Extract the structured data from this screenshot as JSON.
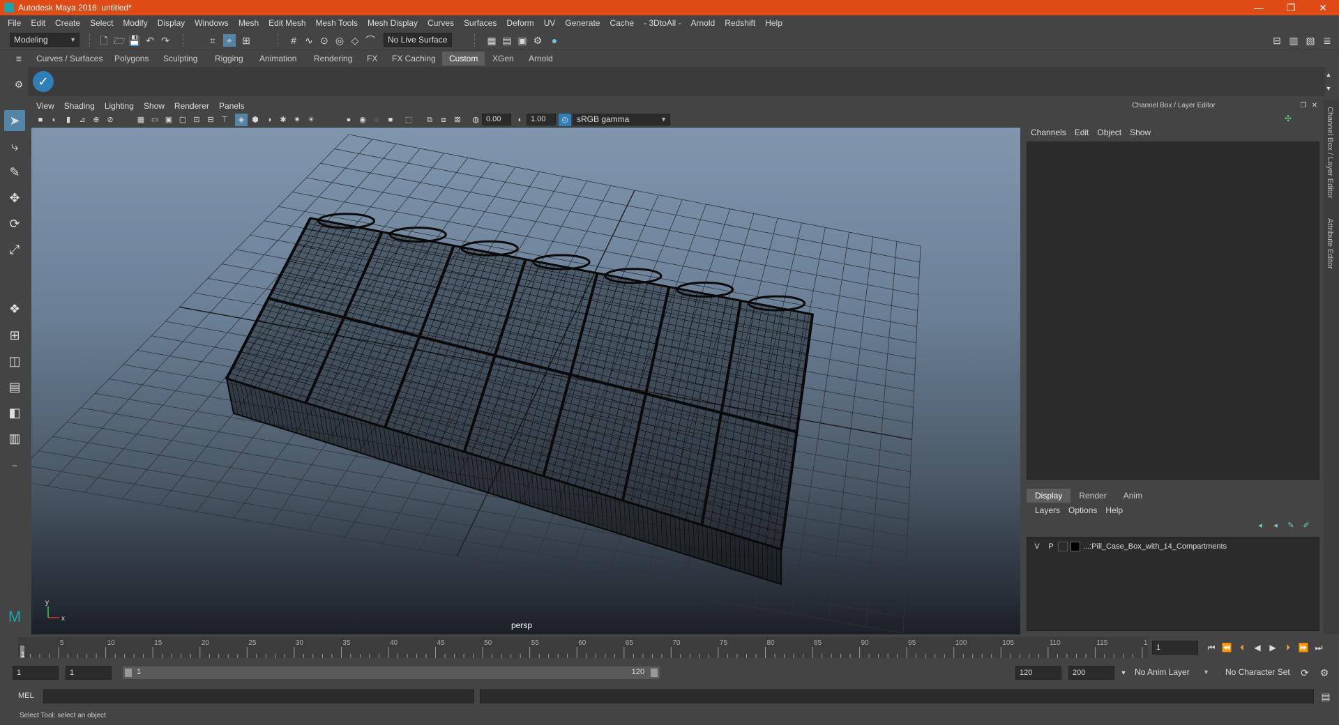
{
  "window": {
    "title": "Autodesk Maya 2016: untitled*"
  },
  "menubar": [
    "File",
    "Edit",
    "Create",
    "Select",
    "Modify",
    "Display",
    "Windows",
    "Mesh",
    "Edit Mesh",
    "Mesh Tools",
    "Mesh Display",
    "Curves",
    "Surfaces",
    "Deform",
    "UV",
    "Generate",
    "Cache",
    "- 3DtoAll -",
    "Arnold",
    "Redshift",
    "Help"
  ],
  "statusline": {
    "mode": "Modeling",
    "live_surface": "No Live Surface"
  },
  "shelf": {
    "tabs": [
      "Curves / Surfaces",
      "Polygons",
      "Sculpting",
      "Rigging",
      "Animation",
      "Rendering",
      "FX",
      "FX Caching",
      "Custom",
      "XGen",
      "Arnold"
    ],
    "active": "Custom"
  },
  "viewport": {
    "menu": [
      "View",
      "Shading",
      "Lighting",
      "Show",
      "Renderer",
      "Panels"
    ],
    "exposure": "0.00",
    "gamma": "1.00",
    "color_space": "sRGB gamma",
    "camera_label": "persp",
    "axis_labels": {
      "x": "x",
      "y": "y"
    }
  },
  "channel_box": {
    "header": "Channel Box / Layer Editor",
    "menu": [
      "Channels",
      "Edit",
      "Object",
      "Show"
    ]
  },
  "layer_editor": {
    "tabs": [
      "Display",
      "Render",
      "Anim"
    ],
    "active_tab": "Display",
    "menu": [
      "Layers",
      "Options",
      "Help"
    ],
    "layers": [
      {
        "v": "V",
        "p": "P",
        "name": "...:Pill_Case_Box_with_14_Compartments"
      }
    ]
  },
  "side_tabs": [
    "Channel Box / Layer Editor",
    "Attribute Editor"
  ],
  "timeline": {
    "start": 1,
    "end": 120,
    "step": 5,
    "current_frame": "1",
    "current_field": "1"
  },
  "range": {
    "start": "1",
    "playback_start": "1",
    "range_bar_start": "1",
    "range_bar_end": "120",
    "playback_end": "120",
    "end": "200",
    "anim_layer": "No Anim Layer",
    "character_set": "No Character Set"
  },
  "command_line": {
    "label": "MEL"
  },
  "help_line": {
    "text": "Select Tool: select an object"
  },
  "colors": {
    "titlebar": "#e04a14",
    "accent": "#5285a6",
    "wire": "#0a0a0a"
  }
}
